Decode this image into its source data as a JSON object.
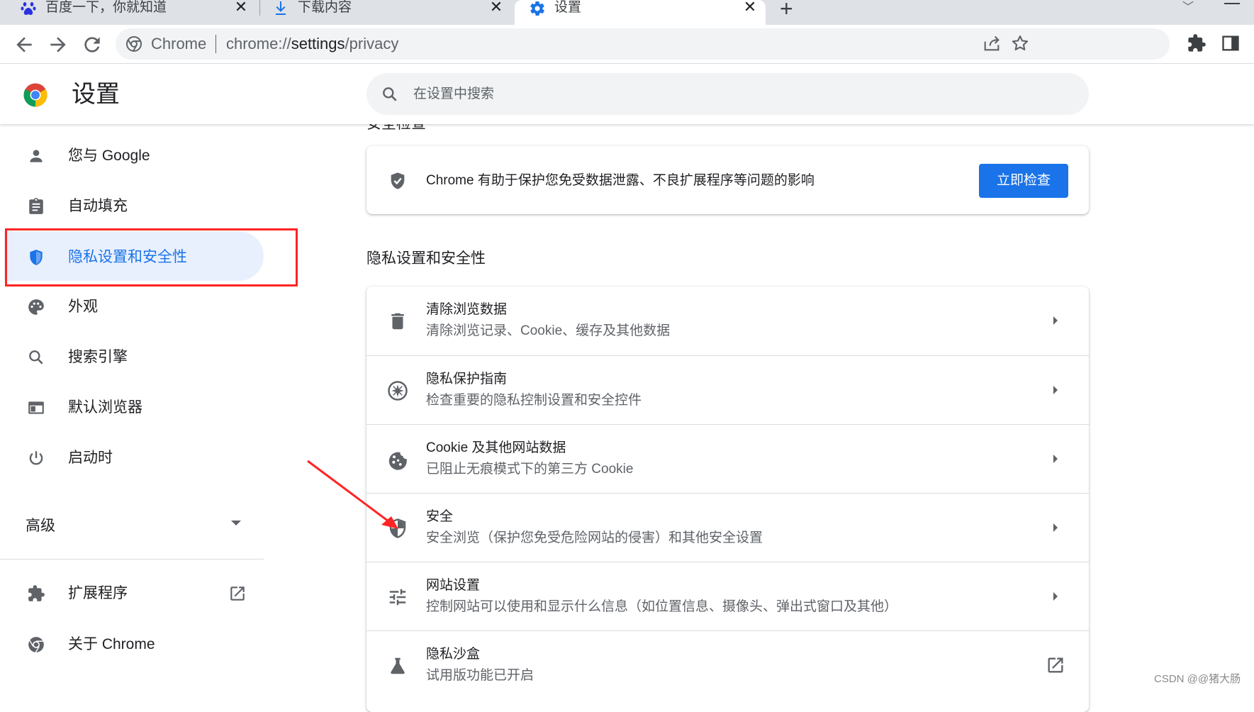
{
  "tabs": [
    {
      "title": "百度一下，你就知道",
      "icon": "baidu-icon"
    },
    {
      "title": "下载内容",
      "icon": "download-icon"
    },
    {
      "title": "设置",
      "icon": "gear-icon",
      "active": true
    }
  ],
  "toolbar": {
    "omnibox_origin": "Chrome",
    "url_prefix": "chrome://",
    "url_host": "settings",
    "url_path": "/privacy"
  },
  "header": {
    "title": "设置",
    "search_placeholder": "在设置中搜索"
  },
  "sidebar": {
    "items": [
      {
        "label": "您与 Google",
        "icon": "person-icon"
      },
      {
        "label": "自动填充",
        "icon": "clipboard-icon"
      },
      {
        "label": "隐私设置和安全性",
        "icon": "shield-icon",
        "selected": true
      },
      {
        "label": "外观",
        "icon": "palette-icon"
      },
      {
        "label": "搜索引擎",
        "icon": "search-icon"
      },
      {
        "label": "默认浏览器",
        "icon": "browser-window-icon"
      },
      {
        "label": "启动时",
        "icon": "power-icon"
      }
    ],
    "advanced_label": "高级",
    "extensions_label": "扩展程序",
    "about_label": "关于 Chrome"
  },
  "main": {
    "peek_heading": "安全检查",
    "safety_check": {
      "text": "Chrome 有助于保护您免受数据泄露、不良扩展程序等问题的影响",
      "button_label": "立即检查"
    },
    "section_heading": "隐私设置和安全性",
    "rows": [
      {
        "title": "清除浏览数据",
        "subtitle": "清除浏览记录、Cookie、缓存及其他数据",
        "icon": "trash-icon"
      },
      {
        "title": "隐私保护指南",
        "subtitle": "检查重要的隐私控制设置和安全控件",
        "icon": "compass-icon"
      },
      {
        "title": "Cookie 及其他网站数据",
        "subtitle": "已阻止无痕模式下的第三方 Cookie",
        "icon": "cookie-icon"
      },
      {
        "title": "安全",
        "subtitle": "安全浏览（保护您免受危险网站的侵害）和其他安全设置",
        "icon": "security-shield-icon"
      },
      {
        "title": "网站设置",
        "subtitle": "控制网站可以使用和显示什么信息（如位置信息、摄像头、弹出式窗口及其他）",
        "icon": "tune-icon"
      },
      {
        "title": "隐私沙盒",
        "subtitle": "试用版功能已开启",
        "icon": "flask-icon"
      }
    ]
  },
  "watermark": "CSDN @@猪大肠",
  "colors": {
    "accent": "#1a73e8",
    "selected_bg": "#e8f0fe",
    "annotation_red": "#ff2424"
  }
}
